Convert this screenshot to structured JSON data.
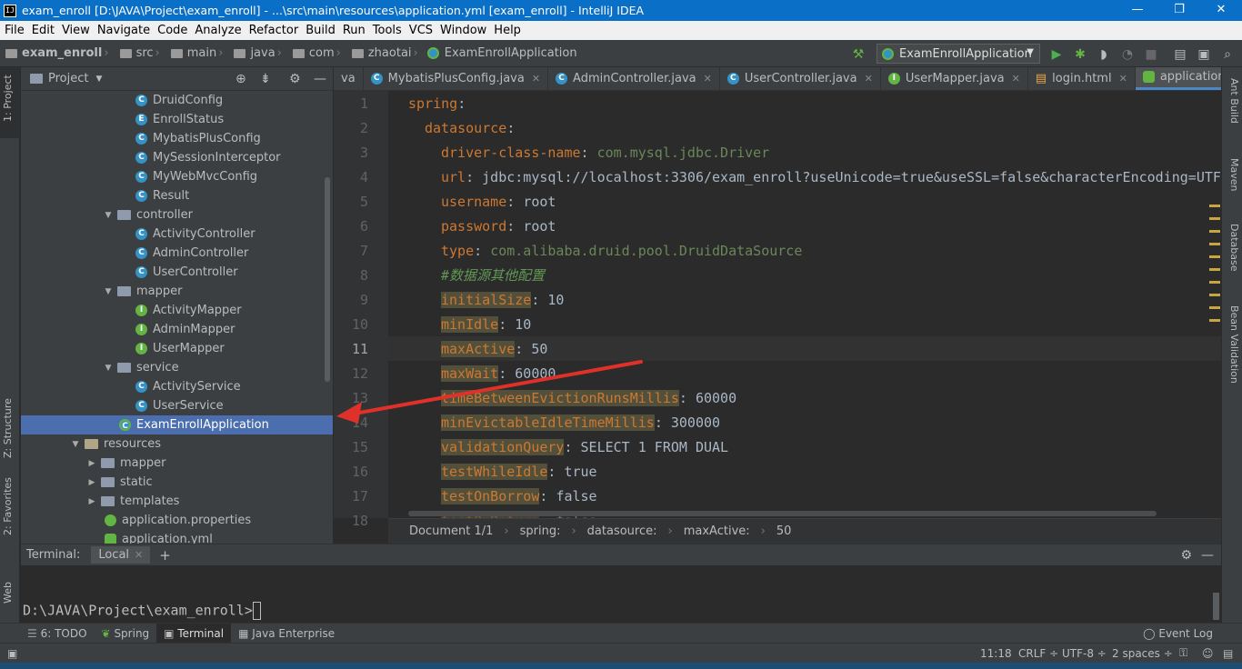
{
  "window": {
    "title": "exam_enroll [D:\\JAVA\\Project\\exam_enroll] - ...\\src\\main\\resources\\application.yml [exam_enroll] - IntelliJ IDEA",
    "app_icon_text": "IJ",
    "minimize": "—",
    "maximize": "❐",
    "close": "✕"
  },
  "menu": [
    "File",
    "Edit",
    "View",
    "Navigate",
    "Code",
    "Analyze",
    "Refactor",
    "Build",
    "Run",
    "Tools",
    "VCS",
    "Window",
    "Help"
  ],
  "breadcrumbs": [
    "exam_enroll",
    "src",
    "main",
    "java",
    "com",
    "zhaotai",
    "ExamEnrollApplication"
  ],
  "run_config": {
    "label": "ExamEnrollApplication"
  },
  "project_panel": {
    "title": "Project",
    "rows": [
      {
        "label": "DruidConfig",
        "icon": "class-icon",
        "glyph": "C"
      },
      {
        "label": "EnrollStatus",
        "icon": "enum-icon",
        "glyph": "E"
      },
      {
        "label": "MybatisPlusConfig",
        "icon": "class-icon",
        "glyph": "C"
      },
      {
        "label": "MySessionInterceptor",
        "icon": "class-icon",
        "glyph": "C"
      },
      {
        "label": "MyWebMvcConfig",
        "icon": "class-icon",
        "glyph": "C"
      },
      {
        "label": "Result",
        "icon": "class-icon",
        "glyph": "C"
      },
      {
        "label": "controller",
        "icon": "package-icon",
        "glyph": "▼"
      },
      {
        "label": "ActivityController",
        "icon": "class-icon",
        "glyph": "C"
      },
      {
        "label": "AdminController",
        "icon": "class-icon",
        "glyph": "C"
      },
      {
        "label": "UserController",
        "icon": "class-icon",
        "glyph": "C"
      },
      {
        "label": "mapper",
        "icon": "package-icon",
        "glyph": "▼"
      },
      {
        "label": "ActivityMapper",
        "icon": "interface-icon",
        "glyph": "I"
      },
      {
        "label": "AdminMapper",
        "icon": "interface-icon",
        "glyph": "I"
      },
      {
        "label": "UserMapper",
        "icon": "interface-icon",
        "glyph": "I"
      },
      {
        "label": "service",
        "icon": "package-icon",
        "glyph": "▼"
      },
      {
        "label": "ActivityService",
        "icon": "class-icon",
        "glyph": "C"
      },
      {
        "label": "UserService",
        "icon": "class-icon",
        "glyph": "C"
      },
      {
        "label": "ExamEnrollApplication",
        "icon": "spring-app-icon",
        "glyph": "C"
      },
      {
        "label": "resources",
        "icon": "folder-icon",
        "glyph": "▼"
      },
      {
        "label": "mapper",
        "icon": "folder-icon",
        "glyph": "▶"
      },
      {
        "label": "static",
        "icon": "folder-icon",
        "glyph": "▶"
      },
      {
        "label": "templates",
        "icon": "folder-icon",
        "glyph": "▶"
      },
      {
        "label": "application.properties",
        "icon": "properties-icon",
        "glyph": ""
      },
      {
        "label": "application.yml",
        "icon": "yml-icon",
        "glyph": ""
      }
    ]
  },
  "editor_tabs": [
    {
      "label": "va",
      "active": false
    },
    {
      "label": "MybatisPlusConfig.java",
      "active": false
    },
    {
      "label": "AdminController.java",
      "active": false
    },
    {
      "label": "UserController.java",
      "active": false
    },
    {
      "label": "UserMapper.java",
      "active": false
    },
    {
      "label": "login.html",
      "active": false
    },
    {
      "label": "application.yml",
      "active": true
    }
  ],
  "tab_overflow": "≡4",
  "code_lines": [
    {
      "n": "1",
      "key": "spring",
      "val": "",
      "indent": 0,
      "hl": false,
      "comment": false
    },
    {
      "n": "2",
      "key": "datasource",
      "val": "",
      "indent": 1,
      "hl": false,
      "comment": false
    },
    {
      "n": "3",
      "key": "driver-class-name",
      "val": "com.mysql.jdbc.Driver",
      "indent": 2,
      "hl": false,
      "comment": false
    },
    {
      "n": "4",
      "key": "url",
      "val": "jdbc:mysql://localhost:3306/exam_enroll?useUnicode=true&useSSL=false&characterEncoding=UTF-",
      "indent": 2,
      "hl": false,
      "comment": false
    },
    {
      "n": "5",
      "key": "username",
      "val": "root",
      "indent": 2,
      "hl": false,
      "comment": false
    },
    {
      "n": "6",
      "key": "password",
      "val": "root",
      "indent": 2,
      "hl": false,
      "comment": false
    },
    {
      "n": "7",
      "key": "type",
      "val": "com.alibaba.druid.pool.DruidDataSource",
      "indent": 2,
      "hl": false,
      "comment": false
    },
    {
      "n": "8",
      "key": "#数据源其他配置",
      "val": "",
      "indent": 2,
      "hl": false,
      "comment": true
    },
    {
      "n": "9",
      "key": "initialSize",
      "val": "10",
      "indent": 2,
      "hl": true,
      "comment": false
    },
    {
      "n": "10",
      "key": "minIdle",
      "val": "10",
      "indent": 2,
      "hl": true,
      "comment": false
    },
    {
      "n": "11",
      "key": "maxActive",
      "val": "50",
      "indent": 2,
      "hl": true,
      "comment": false
    },
    {
      "n": "12",
      "key": "maxWait",
      "val": "60000",
      "indent": 2,
      "hl": true,
      "comment": false
    },
    {
      "n": "13",
      "key": "timeBetweenEvictionRunsMillis",
      "val": "60000",
      "indent": 2,
      "hl": true,
      "comment": false
    },
    {
      "n": "14",
      "key": "minEvictableIdleTimeMillis",
      "val": "300000",
      "indent": 2,
      "hl": true,
      "comment": false
    },
    {
      "n": "15",
      "key": "validationQuery",
      "val": "SELECT 1 FROM DUAL",
      "indent": 2,
      "hl": true,
      "comment": false
    },
    {
      "n": "16",
      "key": "testWhileIdle",
      "val": "true",
      "indent": 2,
      "hl": true,
      "comment": false
    },
    {
      "n": "17",
      "key": "testOnBorrow",
      "val": "false",
      "indent": 2,
      "hl": true,
      "comment": false
    },
    {
      "n": "18",
      "key": "testOnReturn",
      "val": "false",
      "indent": 2,
      "hl": true,
      "comment": false
    }
  ],
  "editor_breadcrumb": [
    "Document 1/1",
    "spring:",
    "datasource:",
    "maxActive:",
    "50"
  ],
  "terminal": {
    "label": "Terminal:",
    "tab": "Local",
    "prompt": "D:\\JAVA\\Project\\exam_enroll>"
  },
  "tool_tabs": [
    {
      "label": "6: TODO",
      "active": false
    },
    {
      "label": "Spring",
      "active": false
    },
    {
      "label": "Terminal",
      "active": true
    },
    {
      "label": "Java Enterprise",
      "active": false
    }
  ],
  "event_log": "Event Log",
  "status": {
    "position": "11:18",
    "line_sep": "CRLF ÷",
    "encoding": "UTF-8 ÷",
    "indent": "2 spaces ÷"
  },
  "left_strip": {
    "project": "1: Project",
    "structure": "Z: Structure",
    "favorites": "2: Favorites",
    "web": "Web"
  },
  "right_strip": {
    "ant": "Ant Build",
    "maven": "Maven",
    "database": "Database",
    "bean": "Bean Validation"
  },
  "colors": {
    "selection": "#4b6eaf",
    "accent": "#4a88c7",
    "keyword": "#cc7832",
    "annotation_arrow": "#e0302a"
  }
}
